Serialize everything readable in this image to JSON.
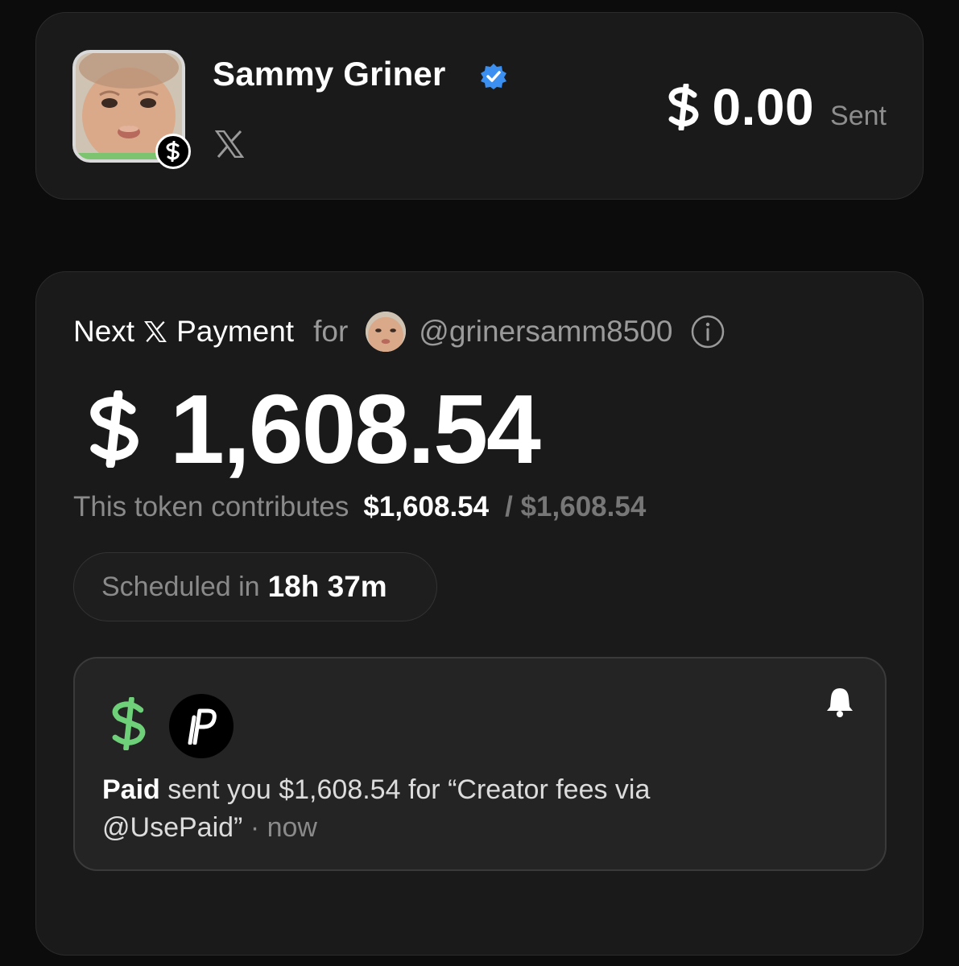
{
  "profile": {
    "name": "Sammy Griner",
    "sent_amount": "0.00",
    "sent_label": "Sent",
    "avatar_icon": "toddler-face-avatar",
    "verified_icon": "verified-badge-icon",
    "platform_icon": "x-logo-icon",
    "colors": {
      "verified": "#3b8ff0",
      "card": "#1a1a1a",
      "background": "#0c0c0c"
    }
  },
  "payment": {
    "next_label": "Next",
    "payment_label": "Payment",
    "for_label": "for",
    "handle": "@grinersamm8500",
    "amount": "1,608.54",
    "contrib_label": "This token contributes",
    "contrib_amount": "$1,608.54",
    "contrib_total": "/ $1,608.54",
    "schedule_label": "Scheduled in",
    "schedule_time": "18h 37m"
  },
  "notification": {
    "sender": "Paid",
    "message": "sent you $1,608.54 for “Creator fees via @UsePaid”",
    "time": "· now",
    "icons": [
      "cash-app-dollar-icon",
      "paid-logo-icon",
      "bell-icon"
    ],
    "colors": {
      "cash_icon": "#6fd07a"
    }
  }
}
